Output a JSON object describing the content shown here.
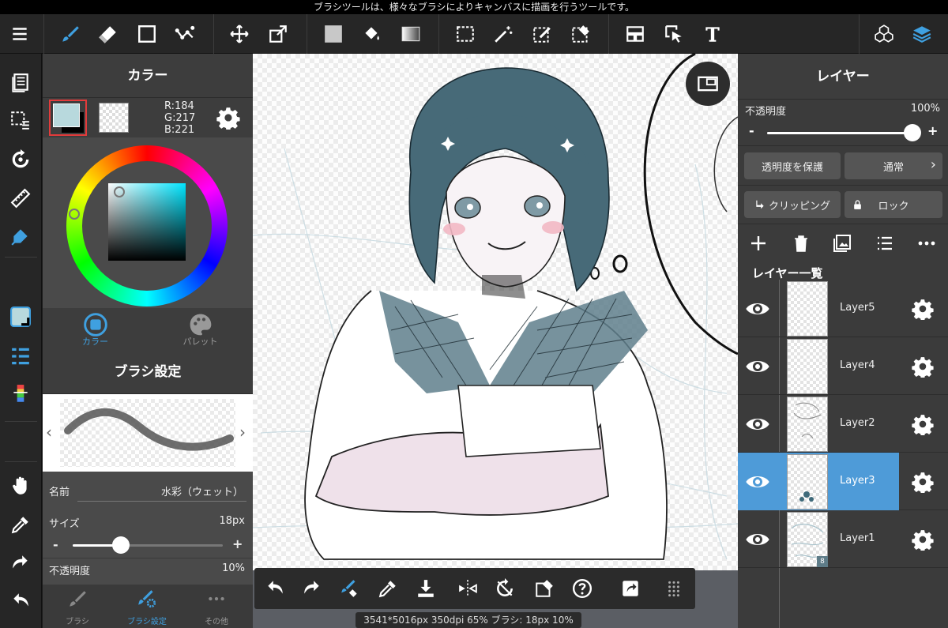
{
  "hint": "ブラシツールは、様々なブラシによりキャンバスに描画を行うツールです。",
  "toolbar": {
    "icons": [
      "menu-icon",
      "brush-icon",
      "eraser-icon",
      "rectangle-icon",
      "dot-line-icon",
      "move-icon",
      "transform-icon",
      "fill-color-icon",
      "bucket-icon",
      "gradient-icon",
      "select-rect-icon",
      "magic-wand-icon",
      "select-pen-icon",
      "select-eraser-icon",
      "snap-icon",
      "operation-icon",
      "text-icon",
      "3d-icon",
      "layers-icon"
    ]
  },
  "color_panel": {
    "title": "カラー",
    "rgb": {
      "r": "R:184",
      "g": "G:217",
      "b": "B:221"
    },
    "fg_color": "#b8d9dd",
    "tabs": [
      {
        "label": "カラー"
      },
      {
        "label": "パレット"
      }
    ]
  },
  "brush_panel": {
    "title": "ブラシ設定",
    "name_label": "名前",
    "name_value": "水彩（ウェット）",
    "size_label": "サイズ",
    "size_value": "18px",
    "size_minus": "-",
    "size_plus": "+",
    "size_fraction": 0.32,
    "opacity_label": "不透明度",
    "opacity_value": "10%",
    "tabs": [
      {
        "label": "ブラシ"
      },
      {
        "label": "ブラシ設定"
      },
      {
        "label": "その他"
      }
    ]
  },
  "status": "3541*5016px 350dpi 65% ブラシ: 18px 10%",
  "bottom_icons": [
    "undo-icon",
    "redo-icon",
    "brush-eraser-toggle-icon",
    "eyedropper-icon",
    "save-icon",
    "flip-icon",
    "rotate-reset-icon",
    "clear-icon",
    "help-icon",
    "share-icon",
    "grid-icon"
  ],
  "layer_panel": {
    "title": "レイヤー",
    "opacity_label": "不透明度",
    "opacity_value": "100%",
    "opacity_fraction": 1.0,
    "slider_minus": "-",
    "slider_plus": "+",
    "protect_alpha": "透明度を保護",
    "blend_mode": "通常",
    "clipping": "クリッピング",
    "lock": "ロック",
    "list_title": "レイヤー一覧",
    "layers": [
      {
        "name": "Layer5",
        "selected": false
      },
      {
        "name": "Layer4",
        "selected": false
      },
      {
        "name": "Layer2",
        "selected": false
      },
      {
        "name": "Layer3",
        "selected": true
      },
      {
        "name": "Layer1",
        "selected": false,
        "badge": "8"
      }
    ]
  }
}
